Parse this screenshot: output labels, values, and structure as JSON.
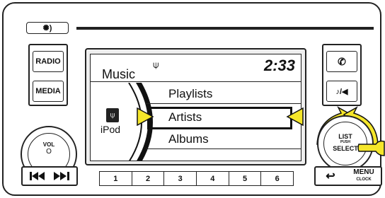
{
  "top_left_button": {
    "icon": "day-night-icon"
  },
  "left_buttons": {
    "radio": "RADIO",
    "media": "MEDIA"
  },
  "vol_knob": {
    "label": "VOL",
    "power_symbol": "O"
  },
  "screen": {
    "title": "Music",
    "source_icon": "usb-icon",
    "clock": "2:33",
    "device_label": "iPod",
    "items": [
      "Playlists",
      "Artists",
      "Albums"
    ],
    "selected_index": 1
  },
  "presets": [
    "1",
    "2",
    "3",
    "4",
    "5",
    "6"
  ],
  "right_buttons": {
    "phone_icon": "phone-icon",
    "voice_icon": "voice-icon",
    "voice_glyph": "♪/◀"
  },
  "list_knob": {
    "label_top": "LIST",
    "label_push": "PUSH",
    "label_bottom": "SELECT"
  },
  "back_button": {
    "icon": "back-arrow-icon"
  },
  "menu_button": {
    "label": "MENU",
    "sublabel": "CLOCK"
  },
  "colors": {
    "highlight": "#f5e62a",
    "highlight_edge": "#c9a800",
    "display_accent": "#111111"
  }
}
